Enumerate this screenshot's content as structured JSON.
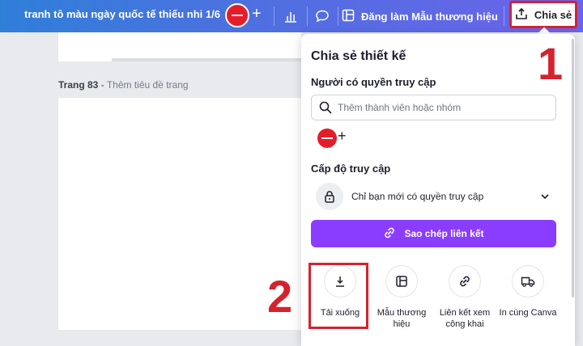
{
  "topbar": {
    "doc_title": "tranh tô màu ngày quốc tế thiếu nhi 1/6",
    "add_icon": "plus-icon",
    "analytics_icon": "bar-chart-icon",
    "comment_icon": "comment-icon",
    "brand_label": "Đăng làm Mẫu thương hiệu",
    "share_label": "Chia sẻ"
  },
  "canvas": {
    "page_number": "Trang 83",
    "page_subtitle": "Thêm tiêu đề trang"
  },
  "share_panel": {
    "title": "Chia sẻ thiết kế",
    "people_label": "Người có quyền truy cập",
    "search_placeholder": "Thêm thành viên hoặc nhóm",
    "access_level_label": "Cấp độ truy cập",
    "access_level_value": "Chỉ bạn mới có quyền truy cập",
    "copy_link_label": "Sao chép liên kết",
    "options": [
      {
        "label": "Tải xuống",
        "icon": "download-icon"
      },
      {
        "label": "Mẫu thương hiệu",
        "icon": "template-icon"
      },
      {
        "label": "Liên kết xem công khai",
        "icon": "link-icon"
      },
      {
        "label": "In cùng Canva",
        "icon": "truck-icon"
      }
    ]
  },
  "annotations": {
    "step1": "1",
    "step2": "2"
  },
  "colors": {
    "topbar_start": "#2f7fd9",
    "topbar_end": "#6c63ea",
    "primary_button": "#8b3dff",
    "highlight": "#d4232f"
  }
}
